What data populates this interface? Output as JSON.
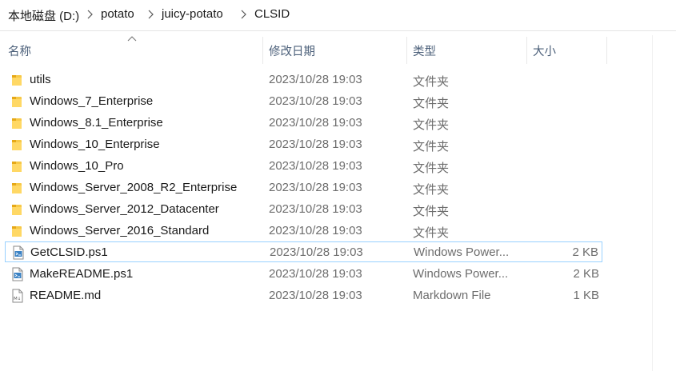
{
  "breadcrumb": [
    "本地磁盘 (D:)",
    "potato",
    "juicy-potato",
    "CLSID"
  ],
  "columns": {
    "name": "名称",
    "date": "修改日期",
    "type": "类型",
    "size": "大小"
  },
  "files": [
    {
      "name": "utils",
      "date": "2023/10/28 19:03",
      "type": "文件夹",
      "size": "",
      "icon": "folder-icon"
    },
    {
      "name": "Windows_7_Enterprise",
      "date": "2023/10/28 19:03",
      "type": "文件夹",
      "size": "",
      "icon": "folder-icon"
    },
    {
      "name": "Windows_8.1_Enterprise",
      "date": "2023/10/28 19:03",
      "type": "文件夹",
      "size": "",
      "icon": "folder-icon"
    },
    {
      "name": "Windows_10_Enterprise",
      "date": "2023/10/28 19:03",
      "type": "文件夹",
      "size": "",
      "icon": "folder-icon"
    },
    {
      "name": "Windows_10_Pro",
      "date": "2023/10/28 19:03",
      "type": "文件夹",
      "size": "",
      "icon": "folder-icon"
    },
    {
      "name": "Windows_Server_2008_R2_Enterprise",
      "date": "2023/10/28 19:03",
      "type": "文件夹",
      "size": "",
      "icon": "folder-icon"
    },
    {
      "name": "Windows_Server_2012_Datacenter",
      "date": "2023/10/28 19:03",
      "type": "文件夹",
      "size": "",
      "icon": "folder-icon"
    },
    {
      "name": "Windows_Server_2016_Standard",
      "date": "2023/10/28 19:03",
      "type": "文件夹",
      "size": "",
      "icon": "folder-icon"
    },
    {
      "name": "GetCLSID.ps1",
      "date": "2023/10/28 19:03",
      "type": "Windows Power...",
      "size": "2 KB",
      "icon": "powershell-script-icon",
      "selected": true
    },
    {
      "name": "MakeREADME.ps1",
      "date": "2023/10/28 19:03",
      "type": "Windows Power...",
      "size": "2 KB",
      "icon": "powershell-script-icon"
    },
    {
      "name": "README.md",
      "date": "2023/10/28 19:03",
      "type": "Markdown File",
      "size": "1 KB",
      "icon": "markdown-file-icon"
    }
  ]
}
